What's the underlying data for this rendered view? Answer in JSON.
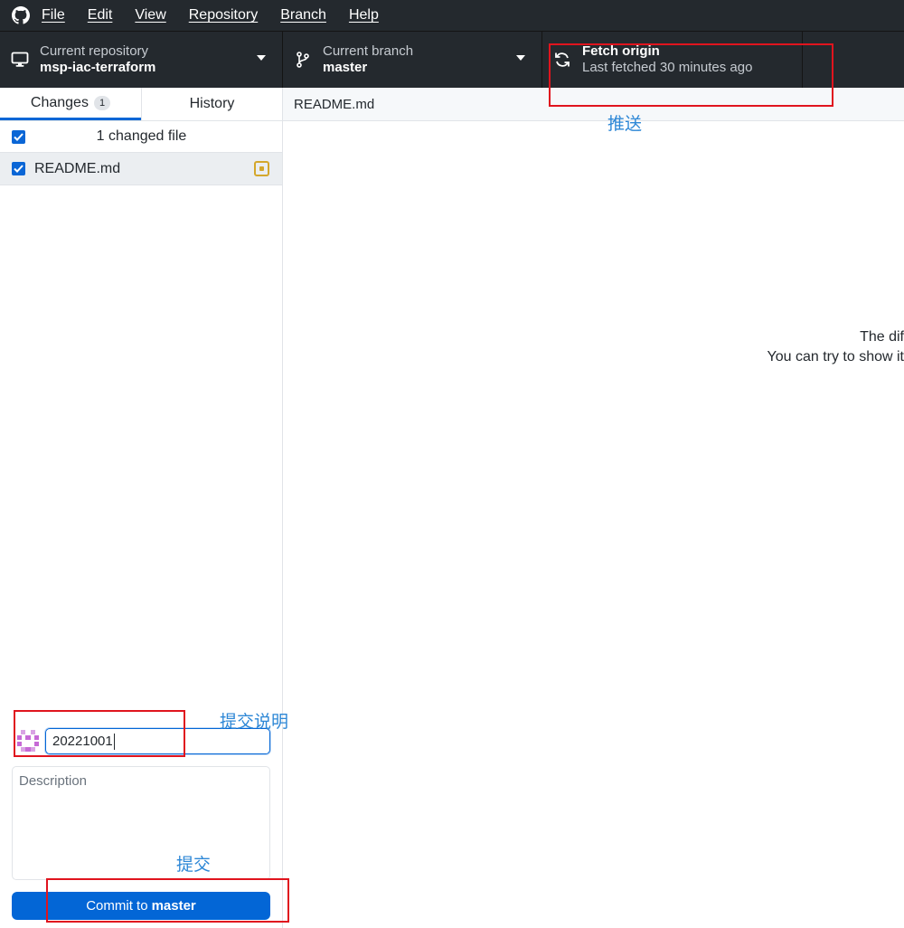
{
  "menu": {
    "items": [
      "File",
      "Edit",
      "View",
      "Repository",
      "Branch",
      "Help"
    ]
  },
  "toolbar": {
    "repo_label": "Current repository",
    "repo_value": "msp-iac-terraform",
    "branch_label": "Current branch",
    "branch_value": "master",
    "fetch_title": "Fetch origin",
    "fetch_subtitle": "Last fetched 30 minutes ago"
  },
  "tabs": {
    "changes_label": "Changes",
    "changes_count": "1",
    "history_label": "History"
  },
  "changes": {
    "summary": "1 changed file",
    "files": [
      {
        "name": "README.md",
        "status": "modified"
      }
    ]
  },
  "commit": {
    "summary_value": "20221001",
    "description_placeholder": "Description",
    "button_prefix": "Commit to",
    "button_branch": "master"
  },
  "diff": {
    "file_header": "README.md",
    "message_line1": "The dif",
    "message_line2": "You can try to show it"
  },
  "annotations": {
    "fetch_note": "推送",
    "summary_note": "提交说明",
    "commit_note": "提交"
  },
  "colors": {
    "toolbar_bg": "#24292e",
    "accent_blue": "#0366d6",
    "annotation_red": "#e0141e",
    "annotation_blue": "#2d87d6",
    "modified_yellow": "#d4a72c"
  }
}
